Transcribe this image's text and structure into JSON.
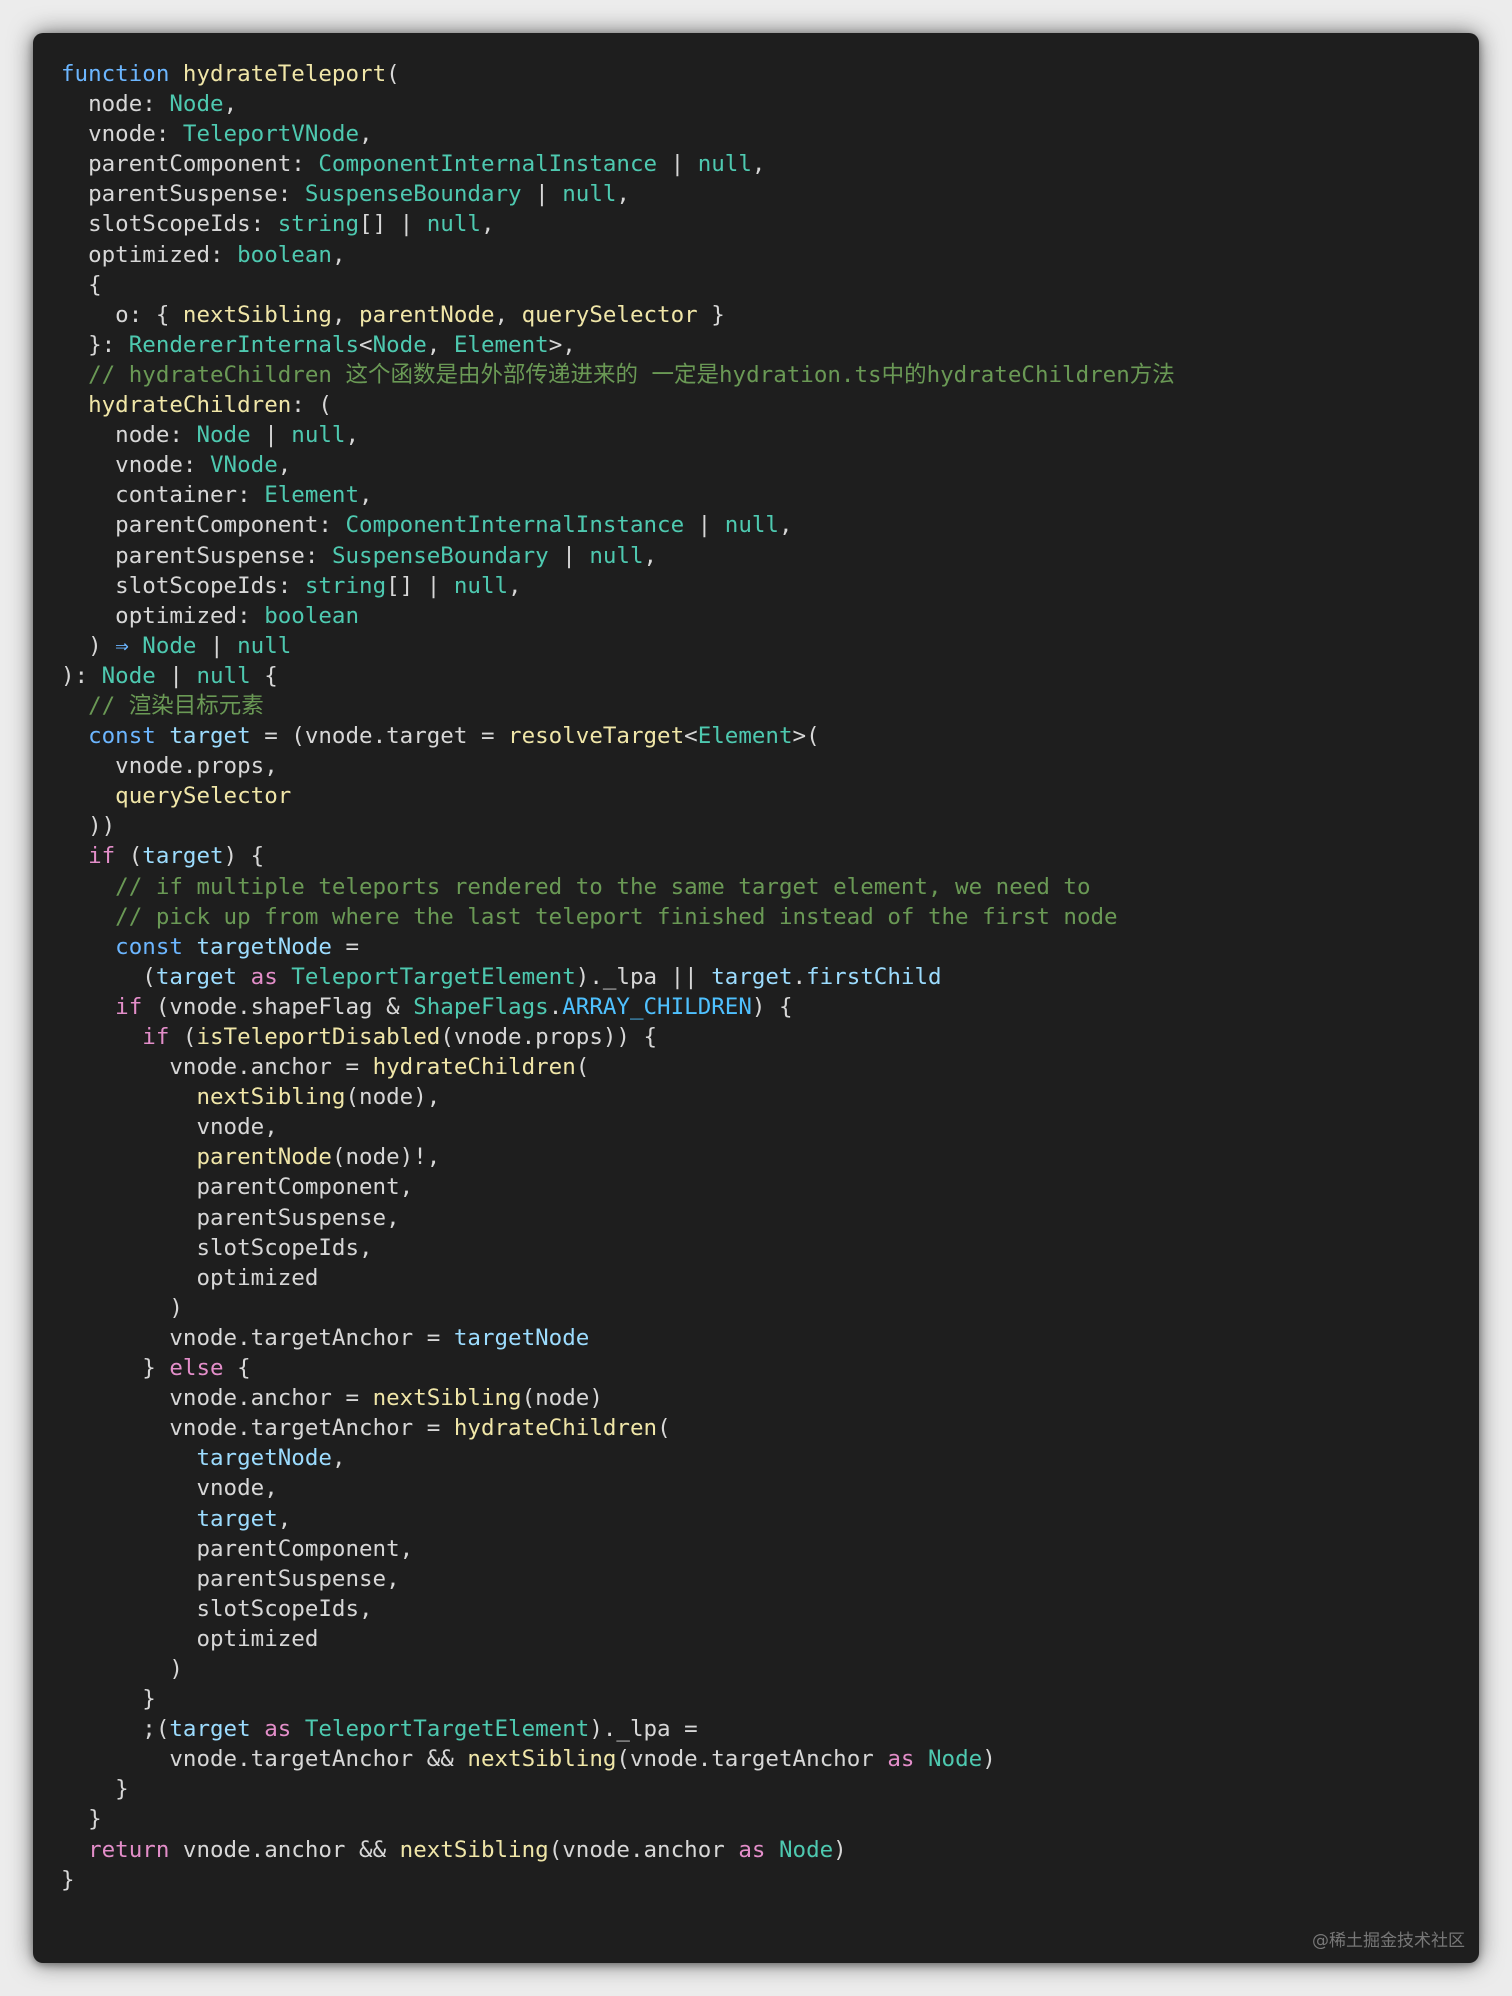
{
  "watermark": "@稀土掘金技术社区",
  "colors": {
    "background": "#1e1e1e",
    "keyword": "#6cb6ff",
    "control_keyword": "#e38ec9",
    "function": "#f0e6a8",
    "type": "#4ec9b0",
    "variable": "#9cdcfe",
    "comment": "#6a9955",
    "constant": "#4fc1ff",
    "plain": "#d7d7d7"
  },
  "code_lines": [
    [
      [
        "kw",
        "function"
      ],
      [
        "pl",
        " "
      ],
      [
        "fn",
        "hydrateTeleport"
      ],
      [
        "pun",
        "("
      ]
    ],
    [
      [
        "pl",
        "  node"
      ],
      [
        "pun",
        ": "
      ],
      [
        "ty",
        "Node"
      ],
      [
        "pun",
        ","
      ]
    ],
    [
      [
        "pl",
        "  vnode"
      ],
      [
        "pun",
        ": "
      ],
      [
        "ty",
        "TeleportVNode"
      ],
      [
        "pun",
        ","
      ]
    ],
    [
      [
        "pl",
        "  parentComponent"
      ],
      [
        "pun",
        ": "
      ],
      [
        "ty",
        "ComponentInternalInstance"
      ],
      [
        "pun",
        " | "
      ],
      [
        "ty",
        "null"
      ],
      [
        "pun",
        ","
      ]
    ],
    [
      [
        "pl",
        "  parentSuspense"
      ],
      [
        "pun",
        ": "
      ],
      [
        "ty",
        "SuspenseBoundary"
      ],
      [
        "pun",
        " | "
      ],
      [
        "ty",
        "null"
      ],
      [
        "pun",
        ","
      ]
    ],
    [
      [
        "pl",
        "  slotScopeIds"
      ],
      [
        "pun",
        ": "
      ],
      [
        "ty",
        "string"
      ],
      [
        "pun",
        "[] | "
      ],
      [
        "ty",
        "null"
      ],
      [
        "pun",
        ","
      ]
    ],
    [
      [
        "pl",
        "  optimized"
      ],
      [
        "pun",
        ": "
      ],
      [
        "ty",
        "boolean"
      ],
      [
        "pun",
        ","
      ]
    ],
    [
      [
        "pun",
        "  {"
      ]
    ],
    [
      [
        "pl",
        "    o"
      ],
      [
        "pun",
        ": { "
      ],
      [
        "fn",
        "nextSibling"
      ],
      [
        "pun",
        ", "
      ],
      [
        "fn",
        "parentNode"
      ],
      [
        "pun",
        ", "
      ],
      [
        "fn",
        "querySelector"
      ],
      [
        "pun",
        " }"
      ]
    ],
    [
      [
        "pun",
        "  }: "
      ],
      [
        "ty",
        "RendererInternals"
      ],
      [
        "pun",
        "<"
      ],
      [
        "ty",
        "Node"
      ],
      [
        "pun",
        ", "
      ],
      [
        "ty",
        "Element"
      ],
      [
        "pun",
        ">,"
      ]
    ],
    [
      [
        "cm",
        "  // hydrateChildren 这个函数是由外部传递进来的 一定是hydration.ts中的hydrateChildren方法"
      ]
    ],
    [
      [
        "fn",
        "  hydrateChildren"
      ],
      [
        "pun",
        ": ("
      ]
    ],
    [
      [
        "pl",
        "    node"
      ],
      [
        "pun",
        ": "
      ],
      [
        "ty",
        "Node"
      ],
      [
        "pun",
        " | "
      ],
      [
        "ty",
        "null"
      ],
      [
        "pun",
        ","
      ]
    ],
    [
      [
        "pl",
        "    vnode"
      ],
      [
        "pun",
        ": "
      ],
      [
        "ty",
        "VNode"
      ],
      [
        "pun",
        ","
      ]
    ],
    [
      [
        "pl",
        "    container"
      ],
      [
        "pun",
        ": "
      ],
      [
        "ty",
        "Element"
      ],
      [
        "pun",
        ","
      ]
    ],
    [
      [
        "pl",
        "    parentComponent"
      ],
      [
        "pun",
        ": "
      ],
      [
        "ty",
        "ComponentInternalInstance"
      ],
      [
        "pun",
        " | "
      ],
      [
        "ty",
        "null"
      ],
      [
        "pun",
        ","
      ]
    ],
    [
      [
        "pl",
        "    parentSuspense"
      ],
      [
        "pun",
        ": "
      ],
      [
        "ty",
        "SuspenseBoundary"
      ],
      [
        "pun",
        " | "
      ],
      [
        "ty",
        "null"
      ],
      [
        "pun",
        ","
      ]
    ],
    [
      [
        "pl",
        "    slotScopeIds"
      ],
      [
        "pun",
        ": "
      ],
      [
        "ty",
        "string"
      ],
      [
        "pun",
        "[] | "
      ],
      [
        "ty",
        "null"
      ],
      [
        "pun",
        ","
      ]
    ],
    [
      [
        "pl",
        "    optimized"
      ],
      [
        "pun",
        ": "
      ],
      [
        "ty",
        "boolean"
      ]
    ],
    [
      [
        "pun",
        "  ) "
      ],
      [
        "kw",
        "⇒"
      ],
      [
        "pun",
        " "
      ],
      [
        "ty",
        "Node"
      ],
      [
        "pun",
        " | "
      ],
      [
        "ty",
        "null"
      ]
    ],
    [
      [
        "pun",
        "): "
      ],
      [
        "ty",
        "Node"
      ],
      [
        "pun",
        " | "
      ],
      [
        "ty",
        "null"
      ],
      [
        "pun",
        " {"
      ]
    ],
    [
      [
        "cm",
        "  // 渲染目标元素"
      ]
    ],
    [
      [
        "kw",
        "  const"
      ],
      [
        "pun",
        " "
      ],
      [
        "var",
        "target"
      ],
      [
        "pun",
        " = ("
      ],
      [
        "pl",
        "vnode"
      ],
      [
        "pun",
        "."
      ],
      [
        "pl",
        "target"
      ],
      [
        "pun",
        " = "
      ],
      [
        "fn",
        "resolveTarget"
      ],
      [
        "pun",
        "<"
      ],
      [
        "ty",
        "Element"
      ],
      [
        "pun",
        ">("
      ]
    ],
    [
      [
        "pl",
        "    vnode"
      ],
      [
        "pun",
        "."
      ],
      [
        "pl",
        "props"
      ],
      [
        "pun",
        ","
      ]
    ],
    [
      [
        "fn",
        "    querySelector"
      ]
    ],
    [
      [
        "pun",
        "  ))"
      ]
    ],
    [
      [
        "kw2",
        "  if"
      ],
      [
        "pun",
        " ("
      ],
      [
        "var",
        "target"
      ],
      [
        "pun",
        ") {"
      ]
    ],
    [
      [
        "cm",
        "    // if multiple teleports rendered to the same target element, we need to"
      ]
    ],
    [
      [
        "cm",
        "    // pick up from where the last teleport finished instead of the first node"
      ]
    ],
    [
      [
        "kw",
        "    const"
      ],
      [
        "pun",
        " "
      ],
      [
        "var",
        "targetNode"
      ],
      [
        "pun",
        " ="
      ]
    ],
    [
      [
        "pun",
        "      ("
      ],
      [
        "var",
        "target"
      ],
      [
        "pun",
        " "
      ],
      [
        "kw2",
        "as"
      ],
      [
        "pun",
        " "
      ],
      [
        "ty",
        "TeleportTargetElement"
      ],
      [
        "pun",
        ")."
      ],
      [
        "pl",
        "_lpa"
      ],
      [
        "pun",
        " || "
      ],
      [
        "var",
        "target"
      ],
      [
        "pun",
        "."
      ],
      [
        "var",
        "firstChild"
      ]
    ],
    [
      [
        "kw2",
        "    if"
      ],
      [
        "pun",
        " ("
      ],
      [
        "pl",
        "vnode"
      ],
      [
        "pun",
        "."
      ],
      [
        "pl",
        "shapeFlag"
      ],
      [
        "pun",
        " & "
      ],
      [
        "ty",
        "ShapeFlags"
      ],
      [
        "pun",
        "."
      ],
      [
        "cst",
        "ARRAY_CHILDREN"
      ],
      [
        "pun",
        ") {"
      ]
    ],
    [
      [
        "kw2",
        "      if"
      ],
      [
        "pun",
        " ("
      ],
      [
        "fn",
        "isTeleportDisabled"
      ],
      [
        "pun",
        "("
      ],
      [
        "pl",
        "vnode"
      ],
      [
        "pun",
        "."
      ],
      [
        "pl",
        "props"
      ],
      [
        "pun",
        ")) {"
      ]
    ],
    [
      [
        "pl",
        "        vnode"
      ],
      [
        "pun",
        "."
      ],
      [
        "pl",
        "anchor"
      ],
      [
        "pun",
        " = "
      ],
      [
        "fn",
        "hydrateChildren"
      ],
      [
        "pun",
        "("
      ]
    ],
    [
      [
        "fn",
        "          nextSibling"
      ],
      [
        "pun",
        "("
      ],
      [
        "pl",
        "node"
      ],
      [
        "pun",
        "),"
      ]
    ],
    [
      [
        "pl",
        "          vnode"
      ],
      [
        "pun",
        ","
      ]
    ],
    [
      [
        "fn",
        "          parentNode"
      ],
      [
        "pun",
        "("
      ],
      [
        "pl",
        "node"
      ],
      [
        "pun",
        ")!,"
      ]
    ],
    [
      [
        "pl",
        "          parentComponent"
      ],
      [
        "pun",
        ","
      ]
    ],
    [
      [
        "pl",
        "          parentSuspense"
      ],
      [
        "pun",
        ","
      ]
    ],
    [
      [
        "pl",
        "          slotScopeIds"
      ],
      [
        "pun",
        ","
      ]
    ],
    [
      [
        "pl",
        "          optimized"
      ]
    ],
    [
      [
        "pun",
        "        )"
      ]
    ],
    [
      [
        "pl",
        "        vnode"
      ],
      [
        "pun",
        "."
      ],
      [
        "pl",
        "targetAnchor"
      ],
      [
        "pun",
        " = "
      ],
      [
        "var",
        "targetNode"
      ]
    ],
    [
      [
        "pun",
        "      } "
      ],
      [
        "kw2",
        "else"
      ],
      [
        "pun",
        " {"
      ]
    ],
    [
      [
        "pl",
        "        vnode"
      ],
      [
        "pun",
        "."
      ],
      [
        "pl",
        "anchor"
      ],
      [
        "pun",
        " = "
      ],
      [
        "fn",
        "nextSibling"
      ],
      [
        "pun",
        "("
      ],
      [
        "pl",
        "node"
      ],
      [
        "pun",
        ")"
      ]
    ],
    [
      [
        "pl",
        "        vnode"
      ],
      [
        "pun",
        "."
      ],
      [
        "pl",
        "targetAnchor"
      ],
      [
        "pun",
        " = "
      ],
      [
        "fn",
        "hydrateChildren"
      ],
      [
        "pun",
        "("
      ]
    ],
    [
      [
        "var",
        "          targetNode"
      ],
      [
        "pun",
        ","
      ]
    ],
    [
      [
        "pl",
        "          vnode"
      ],
      [
        "pun",
        ","
      ]
    ],
    [
      [
        "var",
        "          target"
      ],
      [
        "pun",
        ","
      ]
    ],
    [
      [
        "pl",
        "          parentComponent"
      ],
      [
        "pun",
        ","
      ]
    ],
    [
      [
        "pl",
        "          parentSuspense"
      ],
      [
        "pun",
        ","
      ]
    ],
    [
      [
        "pl",
        "          slotScopeIds"
      ],
      [
        "pun",
        ","
      ]
    ],
    [
      [
        "pl",
        "          optimized"
      ]
    ],
    [
      [
        "pun",
        "        )"
      ]
    ],
    [
      [
        "pun",
        "      }"
      ]
    ],
    [
      [
        "pun",
        "      ;("
      ],
      [
        "var",
        "target"
      ],
      [
        "pun",
        " "
      ],
      [
        "kw2",
        "as"
      ],
      [
        "pun",
        " "
      ],
      [
        "ty",
        "TeleportTargetElement"
      ],
      [
        "pun",
        ")."
      ],
      [
        "pl",
        "_lpa"
      ],
      [
        "pun",
        " ="
      ]
    ],
    [
      [
        "pl",
        "        vnode"
      ],
      [
        "pun",
        "."
      ],
      [
        "pl",
        "targetAnchor"
      ],
      [
        "pun",
        " && "
      ],
      [
        "fn",
        "nextSibling"
      ],
      [
        "pun",
        "("
      ],
      [
        "pl",
        "vnode"
      ],
      [
        "pun",
        "."
      ],
      [
        "pl",
        "targetAnchor"
      ],
      [
        "pun",
        " "
      ],
      [
        "kw2",
        "as"
      ],
      [
        "pun",
        " "
      ],
      [
        "ty",
        "Node"
      ],
      [
        "pun",
        ")"
      ]
    ],
    [
      [
        "pun",
        "    }"
      ]
    ],
    [
      [
        "pun",
        "  }"
      ]
    ],
    [
      [
        "kw2",
        "  return"
      ],
      [
        "pun",
        " "
      ],
      [
        "pl",
        "vnode"
      ],
      [
        "pun",
        "."
      ],
      [
        "pl",
        "anchor"
      ],
      [
        "pun",
        " && "
      ],
      [
        "fn",
        "nextSibling"
      ],
      [
        "pun",
        "("
      ],
      [
        "pl",
        "vnode"
      ],
      [
        "pun",
        "."
      ],
      [
        "pl",
        "anchor"
      ],
      [
        "pun",
        " "
      ],
      [
        "kw2",
        "as"
      ],
      [
        "pun",
        " "
      ],
      [
        "ty",
        "Node"
      ],
      [
        "pun",
        ")"
      ]
    ],
    [
      [
        "pun",
        "}"
      ]
    ]
  ]
}
